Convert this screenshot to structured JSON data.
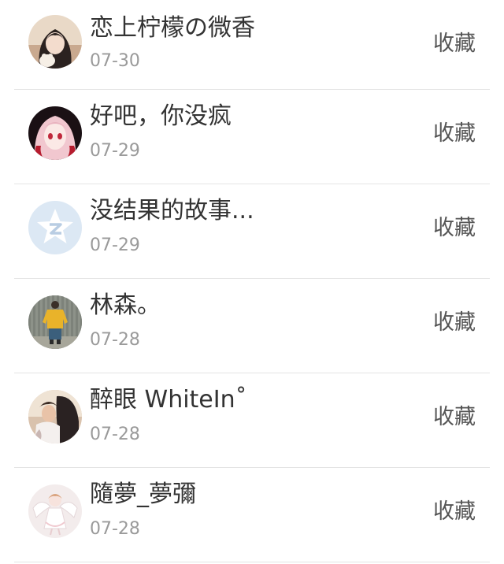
{
  "entries": [
    {
      "name": "恋上柠檬の微香",
      "date": "07-30",
      "action": "收藏",
      "avatar": "girl-photo"
    },
    {
      "name": "好吧，你没疯",
      "date": "07-29",
      "action": "收藏",
      "avatar": "anime-girl"
    },
    {
      "name": "没结果的故事...",
      "date": "07-29",
      "action": "收藏",
      "avatar": "qzone-star-default"
    },
    {
      "name": "林森。",
      "date": "07-28",
      "action": "收藏",
      "avatar": "person-yellow-shirt"
    },
    {
      "name": "醉眼 WhiteIn˚",
      "date": "07-28",
      "action": "收藏",
      "avatar": "couple-photo"
    },
    {
      "name": "隨夢_夢彌",
      "date": "07-28",
      "action": "收藏",
      "avatar": "anime-angel"
    }
  ]
}
